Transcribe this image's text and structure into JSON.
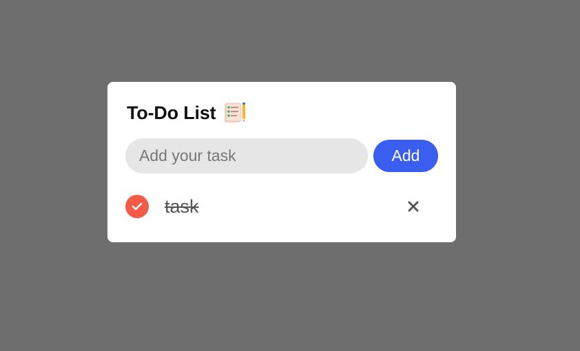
{
  "app": {
    "title": "To-Do List",
    "title_icon": "checklist-pencil-icon"
  },
  "new_task": {
    "placeholder": "Add your task",
    "value": "",
    "add_label": "Add"
  },
  "tasks": [
    {
      "text": "task",
      "completed": true,
      "check_icon": "checkmark-icon",
      "delete_icon": "close-icon"
    }
  ],
  "colors": {
    "background": "#6e6e6e",
    "card": "#ffffff",
    "accent": "#3a5ff0",
    "checked": "#f55a47",
    "input_bg": "#e6e6e6"
  }
}
